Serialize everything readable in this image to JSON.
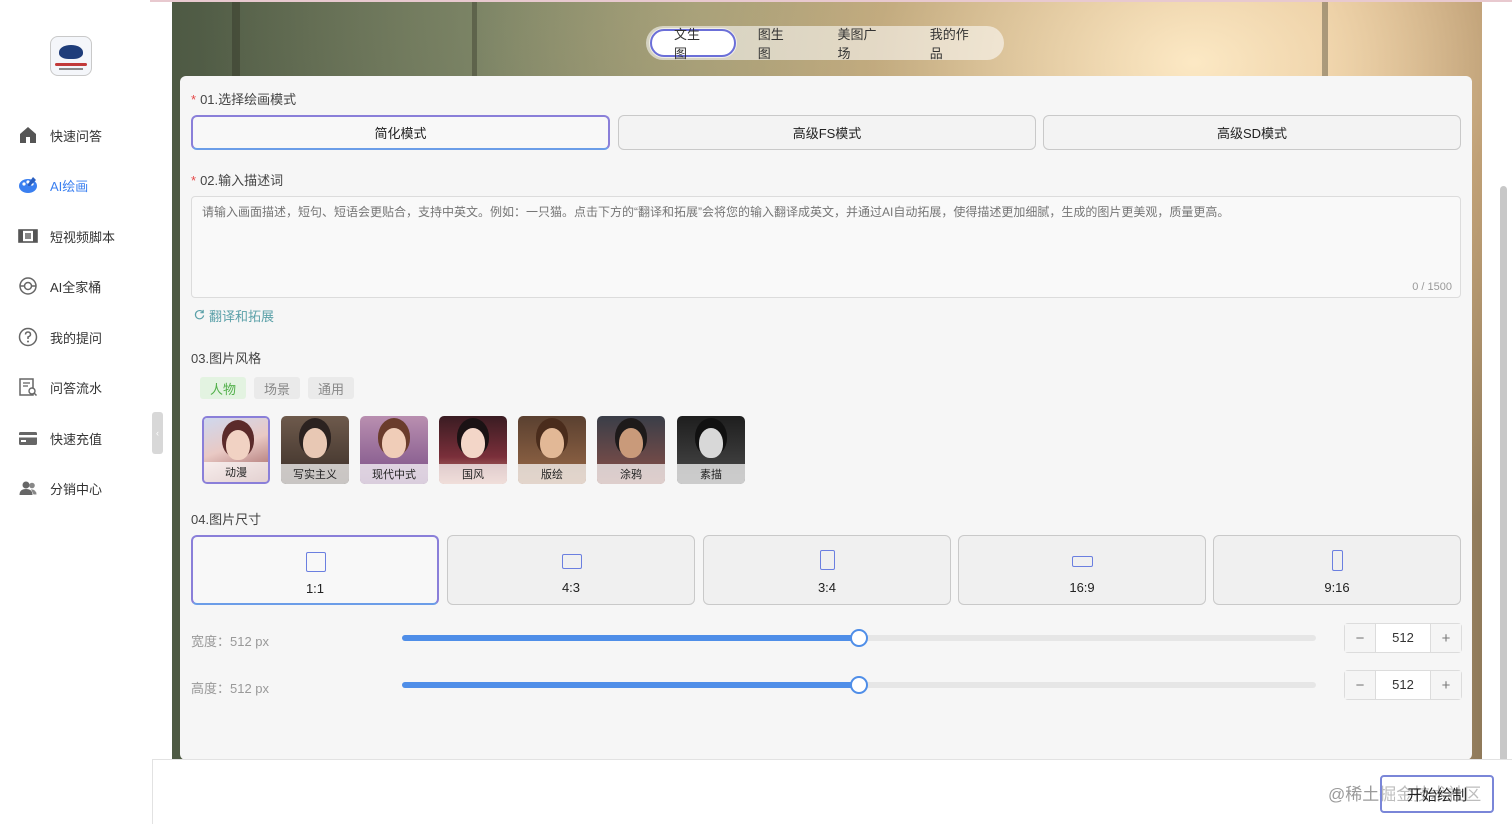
{
  "sidebar": {
    "logo_icon": "app-logo",
    "items": [
      {
        "label": "快速问答",
        "icon": "home-icon"
      },
      {
        "label": "AI绘画",
        "icon": "palette-icon",
        "active": true
      },
      {
        "label": "短视频脚本",
        "icon": "film-icon"
      },
      {
        "label": "AI全家桶",
        "icon": "target-icon"
      },
      {
        "label": "我的提问",
        "icon": "question-icon"
      },
      {
        "label": "问答流水",
        "icon": "document-search-icon"
      },
      {
        "label": "快速充值",
        "icon": "card-icon"
      },
      {
        "label": "分销中心",
        "icon": "users-icon"
      }
    ],
    "collapse_glyph": "‹"
  },
  "header": {
    "tabs": [
      {
        "label": "文生图",
        "active": true
      },
      {
        "label": "图生图"
      },
      {
        "label": "美图广场"
      },
      {
        "label": "我的作品"
      }
    ]
  },
  "form": {
    "mode": {
      "label": "01.选择绘画模式",
      "options": [
        "简化模式",
        "高级FS模式",
        "高级SD模式"
      ],
      "selected": "简化模式"
    },
    "prompt": {
      "label": "02.输入描述词",
      "value": "",
      "placeholder": "请输入画面描述，短句、短语会更贴合，支持中英文。例如：一只猫。点击下方的“翻译和拓展”会将您的输入翻译成英文，并通过AI自动拓展，使得描述更加细腻，生成的图片更美观，质量更高。",
      "counter": "0 / 1500",
      "translate_label": "翻译和拓展"
    },
    "style": {
      "label": "03.图片风格",
      "tabs": [
        "人物",
        "场景",
        "通用"
      ],
      "selected_tab": "人物",
      "presets": [
        "动漫",
        "写实主义",
        "现代中式",
        "国风",
        "版绘",
        "涂鸦",
        "素描"
      ],
      "selected_preset": "动漫"
    },
    "size": {
      "label": "04.图片尺寸",
      "options": [
        "1:1",
        "4:3",
        "3:4",
        "16:9",
        "9:16"
      ],
      "selected": "1:1"
    },
    "width": {
      "label": "宽度：512 px",
      "value": "512",
      "fraction": 0.5
    },
    "height": {
      "label": "高度：512 px",
      "value": "512",
      "fraction": 0.5
    }
  },
  "footer": {
    "start_label": "开始绘制",
    "watermark": "@稀土掘金技术社区"
  },
  "colors": {
    "accent": "#3a7ff0",
    "slider": "#4f8ee8",
    "selected_border": "#8a7fd9",
    "style_tab_active": "#52b04a",
    "required": "#e54848"
  }
}
